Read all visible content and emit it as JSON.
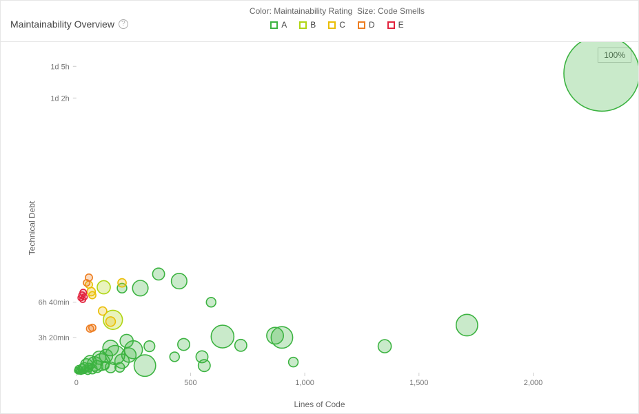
{
  "header": {
    "title": "Maintainability Overview",
    "help": "?",
    "legend_desc_color": "Color: Maintainability Rating",
    "legend_desc_size": "Size: Code Smells",
    "ratings": [
      {
        "key": "A",
        "color": "#3cb341"
      },
      {
        "key": "B",
        "color": "#b0d513"
      },
      {
        "key": "C",
        "color": "#eabe06"
      },
      {
        "key": "D",
        "color": "#ed7d20"
      },
      {
        "key": "E",
        "color": "#e2233d"
      }
    ]
  },
  "badge": "100%",
  "chart_data": {
    "type": "scatter",
    "title": "Maintainability Overview",
    "xlabel": "Lines of Code",
    "ylabel": "Technical Debt",
    "xlim": [
      0,
      2400
    ],
    "ylim_minutes": [
      0,
      1800
    ],
    "x_ticks": [
      0,
      500,
      1000,
      1500,
      2000
    ],
    "y_ticks": [
      {
        "minutes": 200,
        "label": "3h 20min"
      },
      {
        "minutes": 400,
        "label": "6h 40min"
      },
      {
        "minutes": 1560,
        "label": "1d 2h"
      },
      {
        "minutes": 1740,
        "label": "1d 5h"
      }
    ],
    "size_metric": "Code Smells",
    "size_scale": {
      "min_smells": 1,
      "max_smells": 120,
      "min_r": 3,
      "max_r": 55
    },
    "series": [
      {
        "name": "A",
        "color": "#3cb341",
        "points": [
          {
            "x": 2300,
            "y_min": 1700,
            "smells": 120
          },
          {
            "x": 1710,
            "y_min": 270,
            "smells": 30
          },
          {
            "x": 1350,
            "y_min": 150,
            "smells": 16
          },
          {
            "x": 950,
            "y_min": 60,
            "smells": 10
          },
          {
            "x": 900,
            "y_min": 200,
            "smells": 30
          },
          {
            "x": 870,
            "y_min": 210,
            "smells": 22
          },
          {
            "x": 720,
            "y_min": 155,
            "smells": 14
          },
          {
            "x": 590,
            "y_min": 400,
            "smells": 10
          },
          {
            "x": 640,
            "y_min": 205,
            "smells": 32
          },
          {
            "x": 560,
            "y_min": 40,
            "smells": 14
          },
          {
            "x": 550,
            "y_min": 90,
            "smells": 14
          },
          {
            "x": 470,
            "y_min": 160,
            "smells": 14
          },
          {
            "x": 450,
            "y_min": 520,
            "smells": 20
          },
          {
            "x": 430,
            "y_min": 90,
            "smells": 10
          },
          {
            "x": 360,
            "y_min": 560,
            "smells": 14
          },
          {
            "x": 320,
            "y_min": 150,
            "smells": 12
          },
          {
            "x": 300,
            "y_min": 40,
            "smells": 30
          },
          {
            "x": 280,
            "y_min": 480,
            "smells": 20
          },
          {
            "x": 250,
            "y_min": 130,
            "smells": 24
          },
          {
            "x": 230,
            "y_min": 100,
            "smells": 18
          },
          {
            "x": 220,
            "y_min": 180,
            "smells": 16
          },
          {
            "x": 200,
            "y_min": 480,
            "smells": 10
          },
          {
            "x": 200,
            "y_min": 65,
            "smells": 18
          },
          {
            "x": 190,
            "y_min": 30,
            "smells": 10
          },
          {
            "x": 170,
            "y_min": 100,
            "smells": 26
          },
          {
            "x": 150,
            "y_min": 140,
            "smells": 20
          },
          {
            "x": 150,
            "y_min": 30,
            "smells": 12
          },
          {
            "x": 130,
            "y_min": 95,
            "smells": 16
          },
          {
            "x": 125,
            "y_min": 40,
            "smells": 8
          },
          {
            "x": 110,
            "y_min": 60,
            "smells": 22
          },
          {
            "x": 100,
            "y_min": 85,
            "smells": 16
          },
          {
            "x": 90,
            "y_min": 35,
            "smells": 14
          },
          {
            "x": 80,
            "y_min": 50,
            "smells": 18
          },
          {
            "x": 70,
            "y_min": 20,
            "smells": 10
          },
          {
            "x": 60,
            "y_min": 60,
            "smells": 16
          },
          {
            "x": 55,
            "y_min": 30,
            "smells": 8
          },
          {
            "x": 50,
            "y_min": 10,
            "smells": 6
          },
          {
            "x": 45,
            "y_min": 45,
            "smells": 14
          },
          {
            "x": 40,
            "y_min": 20,
            "smells": 6
          },
          {
            "x": 35,
            "y_min": 30,
            "smells": 10
          },
          {
            "x": 30,
            "y_min": 10,
            "smells": 4
          },
          {
            "x": 25,
            "y_min": 25,
            "smells": 8
          },
          {
            "x": 20,
            "y_min": 5,
            "smells": 3
          },
          {
            "x": 15,
            "y_min": 15,
            "smells": 5
          },
          {
            "x": 12,
            "y_min": 8,
            "smells": 3
          },
          {
            "x": 10,
            "y_min": 20,
            "smells": 6
          },
          {
            "x": 8,
            "y_min": 5,
            "smells": 2
          },
          {
            "x": 5,
            "y_min": 12,
            "smells": 4
          }
        ]
      },
      {
        "name": "B",
        "color": "#b0d513",
        "points": [
          {
            "x": 160,
            "y_min": 300,
            "smells": 26
          },
          {
            "x": 120,
            "y_min": 485,
            "smells": 16
          }
        ]
      },
      {
        "name": "C",
        "color": "#eabe06",
        "points": [
          {
            "x": 150,
            "y_min": 290,
            "smells": 10
          },
          {
            "x": 200,
            "y_min": 510,
            "smells": 8
          },
          {
            "x": 115,
            "y_min": 350,
            "smells": 8
          },
          {
            "x": 65,
            "y_min": 460,
            "smells": 8
          },
          {
            "x": 70,
            "y_min": 440,
            "smells": 6
          },
          {
            "x": 55,
            "y_min": 500,
            "smells": 6
          }
        ]
      },
      {
        "name": "D",
        "color": "#ed7d20",
        "points": [
          {
            "x": 55,
            "y_min": 540,
            "smells": 6
          },
          {
            "x": 45,
            "y_min": 510,
            "smells": 5
          },
          {
            "x": 70,
            "y_min": 255,
            "smells": 6
          },
          {
            "x": 60,
            "y_min": 250,
            "smells": 6
          }
        ]
      },
      {
        "name": "E",
        "color": "#e2233d",
        "points": [
          {
            "x": 25,
            "y_min": 440,
            "smells": 5
          },
          {
            "x": 30,
            "y_min": 455,
            "smells": 5
          },
          {
            "x": 20,
            "y_min": 425,
            "smells": 4
          },
          {
            "x": 28,
            "y_min": 415,
            "smells": 4
          },
          {
            "x": 35,
            "y_min": 430,
            "smells": 4
          }
        ]
      }
    ]
  }
}
